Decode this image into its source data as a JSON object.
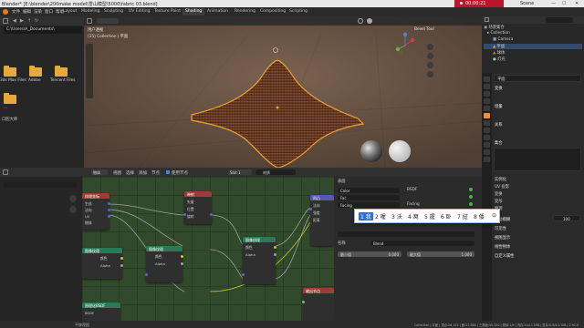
{
  "window": {
    "title": "Blender* [E:\\blender\\200make model\\雪山模型\\5000\\fabric 03.blend]",
    "timer": "00:00:21",
    "scene": "Scene",
    "minimize": "—",
    "maximize": "☐",
    "close": "✕"
  },
  "menubar": {
    "menus": [
      "文件",
      "编辑",
      "渲染",
      "窗口",
      "帮助"
    ],
    "workspaces": [
      "Layout",
      "Modeling",
      "Sculpting",
      "UV Editing",
      "Texture Paint",
      "Shading",
      "Animation",
      "Rendering",
      "Compositing",
      "Scripting"
    ],
    "active_workspace": "Shading"
  },
  "filebrowser": {
    "path": "C:\\Users\\A_Documents\\",
    "folders": [
      {
        "name": "3ds Max Files"
      },
      {
        "name": "Adobe"
      },
      {
        "name": "Tencent Files"
      },
      {
        "name": "..."
      },
      {
        "name": "口腔大师"
      }
    ]
  },
  "viewport": {
    "view_name": "用户透视",
    "collection": "(15) Collection | 平面",
    "tool": "Bevel Tool",
    "colors": {
      "mountain": "#6b3a22",
      "outline": "#f0a030",
      "background": "#6a5445"
    }
  },
  "outliner": {
    "header": "场景集合",
    "items": [
      {
        "label": "Collection"
      },
      {
        "label": "Camera"
      },
      {
        "label": "平面"
      },
      {
        "label": "球体"
      },
      {
        "label": "灯光"
      }
    ]
  },
  "properties": {
    "object": "平面",
    "sections": [
      "变换",
      "增量",
      "关系",
      "集合",
      "实例化",
      "运动模糊",
      "可见性",
      "视图显示",
      "线性物体",
      "自定义属性"
    ],
    "options": [
      "UV 投影",
      "变换",
      "变形",
      "物理"
    ],
    "motion_blur": "运动模糊",
    "value": "100"
  },
  "node_editor": {
    "header": {
      "editor": "物体",
      "menus": [
        "视图",
        "选择",
        "添加",
        "节点"
      ],
      "use_nodes": "使用节点",
      "slot": "Slot 1",
      "material": "材质"
    },
    "nodes": [
      {
        "title": "纹理坐标",
        "color": "#a03a36",
        "rows": [
          "生成",
          "法向",
          "UV",
          "物体"
        ]
      },
      {
        "title": "映射",
        "color": "#a03a36",
        "rows": [
          "矢量",
          "位置",
          "旋转"
        ]
      },
      {
        "title": "图像纹理",
        "color": "#2a7a5a",
        "rows": [
          "颜色",
          "Alpha"
        ]
      },
      {
        "title": "图像纹理",
        "color": "#2a7a5a",
        "rows": [
          "颜色",
          "Alpha"
        ]
      },
      {
        "title": "图像纹理",
        "color": "#2a7a5a",
        "rows": [
          "颜色",
          "Alpha"
        ]
      },
      {
        "title": "凹凸",
        "color": "#5858b0",
        "rows": [
          "法向",
          "强度",
          "距离"
        ]
      },
      {
        "title": "原理化BSDF",
        "color": "#2a7a5a",
        "rows": [
          "BSDF",
          "基础色"
        ]
      }
    ]
  },
  "material_panel": {
    "header": "表面",
    "rows": [
      {
        "label": "Color"
      },
      {
        "label": "Fac"
      },
      {
        "label": "Facing"
      }
    ],
    "bsdf": "BSDF",
    "blend": "Blend",
    "output_label": "输出节点",
    "slider_a": {
      "label": "最小值",
      "value": "0.000"
    },
    "slider_b": {
      "label": "最大值",
      "value": "1.000"
    },
    "name_label": "名称"
  },
  "ime": {
    "candidates": [
      "1 我",
      "2 喔",
      "3 沃",
      "4 窝",
      "5 握",
      "6 卧",
      "7 挝",
      "8 倭"
    ],
    "more": "⊙"
  },
  "statusbar": {
    "left": "平移视图",
    "right": "Collection | 平面 | 顶点:28,152 | 面:27,560 | 三角面:55,120 | 物体:1/4 | 内存:144.1 MiB | 显存:0.9/4.0 GiB | 2.91.0"
  }
}
